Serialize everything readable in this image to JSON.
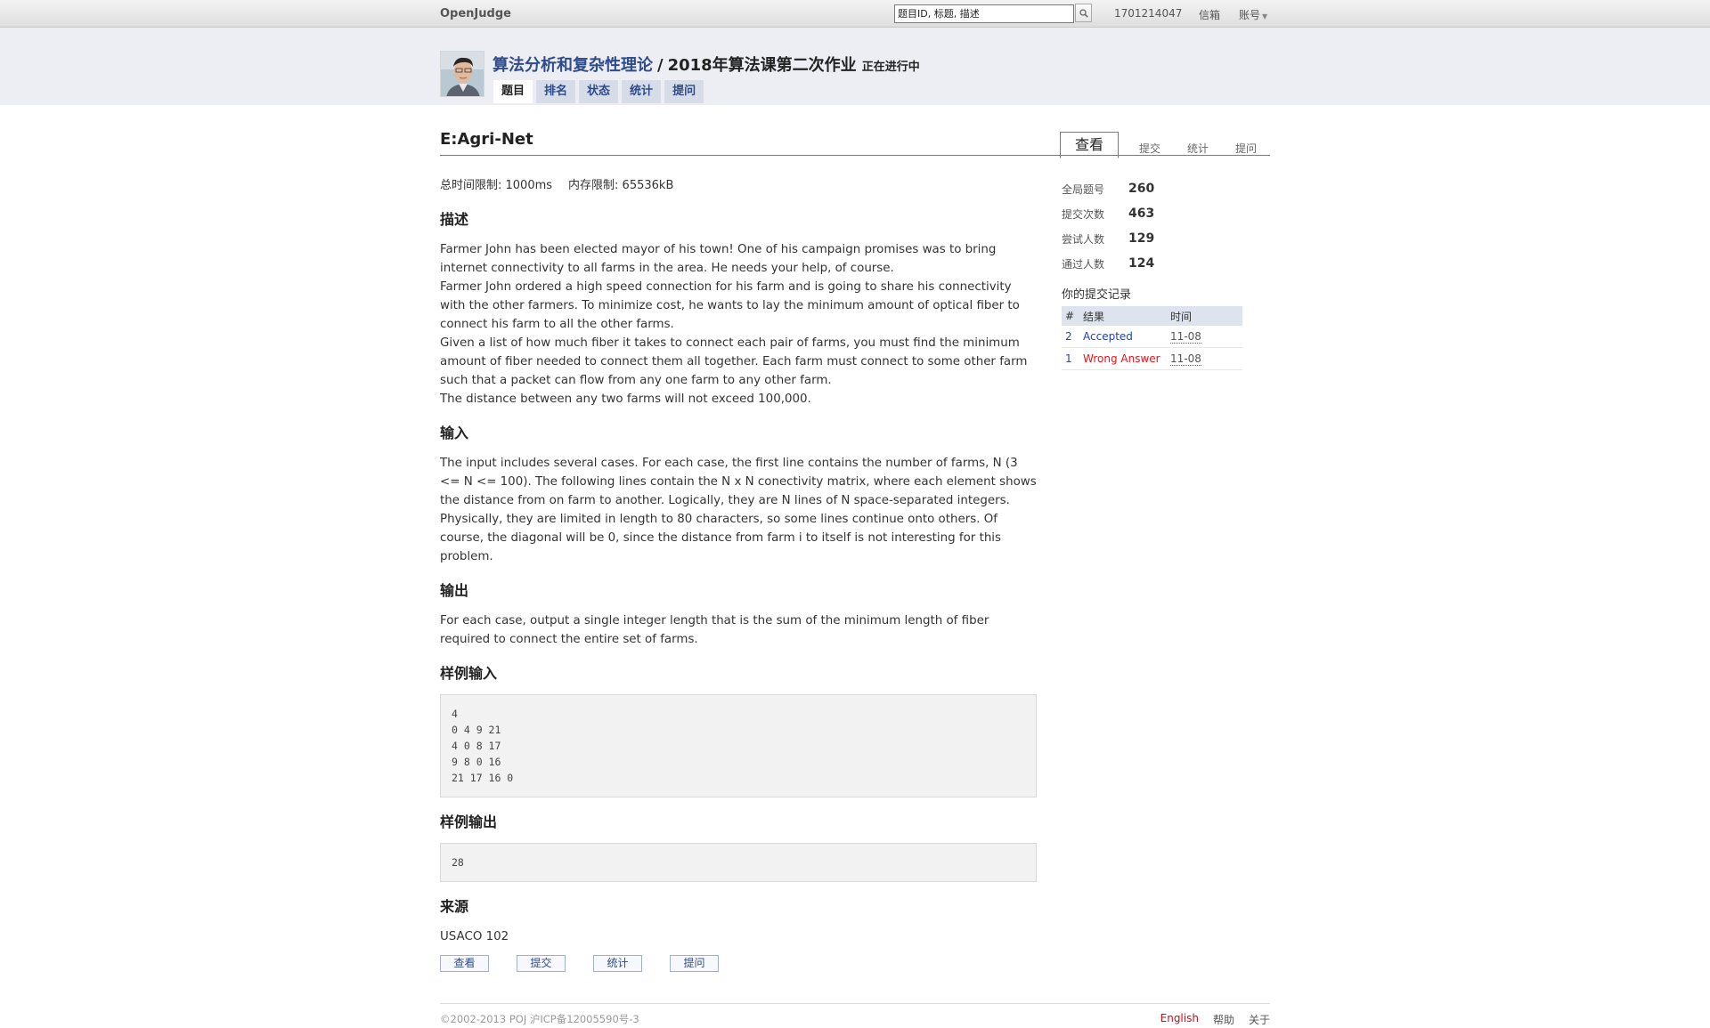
{
  "topbar": {
    "brand": "OpenJudge",
    "search_value": "题目ID, 标题, 描述",
    "user_id": "1701214047",
    "mail": "信箱",
    "account": "账号"
  },
  "header": {
    "course": "算法分析和复杂性理论",
    "separator": "/",
    "homework": "2018年算法课第二次作业",
    "status": "正在进行中",
    "tabs": [
      "题目",
      "排名",
      "状态",
      "统计",
      "提问"
    ]
  },
  "problem": {
    "title": "E:Agri-Net",
    "view_tabs": [
      "查看",
      "提交",
      "统计",
      "提问"
    ],
    "time_limit": "总时间限制: 1000ms",
    "memory_limit": "内存限制: 65536kB",
    "desc_head": "描述",
    "desc_paragraphs": [
      "Farmer John has been elected mayor of his town! One of his campaign promises was to bring internet connectivity to all farms in the area. He needs your help, of course.",
      "Farmer John ordered a high speed connection for his farm and is going to share his connectivity with the other farmers. To minimize cost, he wants to lay the minimum amount of optical fiber to connect his farm to all the other farms.",
      "Given a list of how much fiber it takes to connect each pair of farms, you must find the minimum amount of fiber needed to connect them all together. Each farm must connect to some other farm such that a packet can flow from any one farm to any other farm.",
      "The distance between any two farms will not exceed 100,000."
    ],
    "input_head": "输入",
    "input_text": "The input includes several cases. For each case, the first line contains the number of farms, N (3 <= N <= 100). The following lines contain the N x N conectivity matrix, where each element shows the distance from on farm to another. Logically, they are N lines of N space-separated integers. Physically, they are limited in length to 80 characters, so some lines continue onto others. Of course, the diagonal will be 0, since the distance from farm i to itself is not interesting for this problem.",
    "output_head": "输出",
    "output_text": "For each case, output a single integer length that is the sum of the minimum length of fiber required to connect the entire set of farms.",
    "sample_input_head": "样例输入",
    "sample_input": "4\n0 4 9 21\n4 0 8 17\n9 8 0 16\n21 17 16 0",
    "sample_output_head": "样例输出",
    "sample_output": "28",
    "source_head": "来源",
    "source": "USACO 102",
    "bottom_buttons": [
      "查看",
      "提交",
      "统计",
      "提问"
    ]
  },
  "sidebar": {
    "stats": [
      {
        "label": "全局题号",
        "value": "260"
      },
      {
        "label": "提交次数",
        "value": "463"
      },
      {
        "label": "尝试人数",
        "value": "129"
      },
      {
        "label": "通过人数",
        "value": "124"
      }
    ],
    "record_title": "你的提交记录",
    "record_headers": [
      "#",
      "结果",
      "时间"
    ],
    "records": [
      {
        "num": "2",
        "result": "Accepted",
        "time": "11-08"
      },
      {
        "num": "1",
        "result": "Wrong Answer",
        "time": "11-08"
      }
    ]
  },
  "footer": {
    "copyright": "©2002-2013 POJ 沪ICP备12005590号-3",
    "links": [
      "English",
      "帮助",
      "关于"
    ]
  }
}
